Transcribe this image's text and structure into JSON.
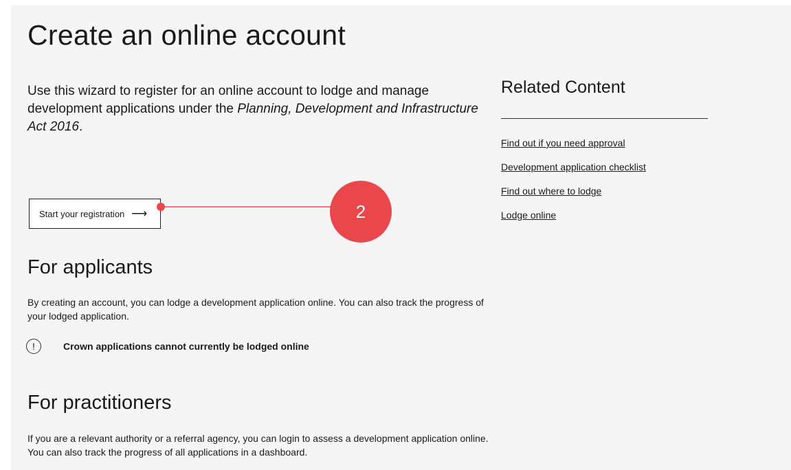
{
  "page": {
    "title": "Create an online account",
    "intro_before": "Use this wizard to register for an online account to lodge and manage development applications under the ",
    "intro_act": "Planning, Development and Infrastructure Act 2016",
    "intro_after": ".",
    "start_button": {
      "label": "Start your registration",
      "arrow": "⟶"
    },
    "callout_number": "2"
  },
  "applicants": {
    "heading": "For applicants",
    "text": "By creating an account, you can lodge a development application online. You can also track the progress of your lodged application.",
    "notice_icon": "!",
    "notice_text": "Crown applications cannot currently be lodged online"
  },
  "practitioners": {
    "heading": "For practitioners",
    "text": "If you are a relevant authority or a referral agency, you can login to assess a development application online. You can also track the progress of all applications in a dashboard."
  },
  "related": {
    "title": "Related Content",
    "links": [
      "Find out if you need approval",
      "Development application checklist",
      "Find out where to lodge",
      "Lodge online"
    ]
  },
  "colors": {
    "callout": "#e9474c",
    "background": "#f5f5f5"
  }
}
